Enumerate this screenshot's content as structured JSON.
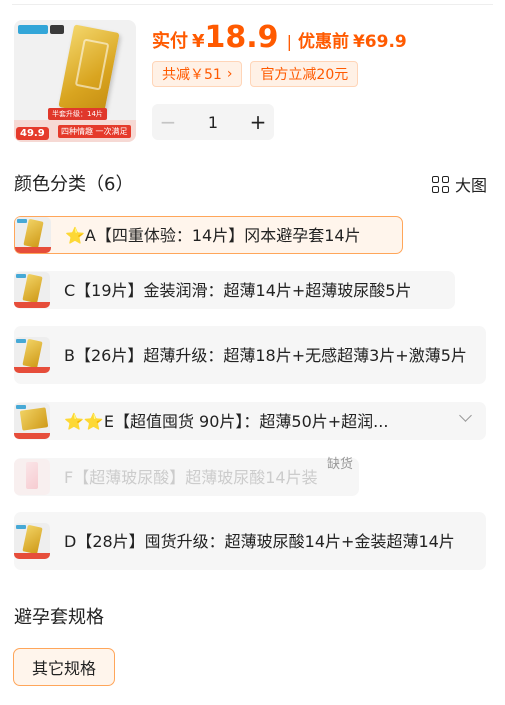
{
  "product": {
    "thumb_price": "49.9",
    "thumb_slogan": "四种情趣 一次满足",
    "thumb_tag": "半套升级：14片"
  },
  "price": {
    "paid_label": "实付",
    "currency": "¥",
    "paid_amount": "18.9",
    "separator": "|",
    "original_label": "优惠前",
    "original_amount": "¥69.9"
  },
  "coupons": [
    {
      "label": "共减￥51",
      "has_arrow": true
    },
    {
      "label": "官方立减20元",
      "has_arrow": false
    }
  ],
  "quantity": {
    "minus": "−",
    "value": "1",
    "plus": "+"
  },
  "color_section": {
    "title": "颜色分类（6）",
    "big_view_label": "大图"
  },
  "options": [
    {
      "label": "⭐A【四重体验：14片】冈本避孕套14片",
      "state": "selected"
    },
    {
      "label": "C【19片】金装润滑：超薄14片+超薄玻尿酸5片",
      "state": "normal"
    },
    {
      "label": "B【26片】超薄升级：超薄18片+无感超薄3片+激薄5片",
      "state": "normal"
    },
    {
      "label": "⭐⭐E【超值囤货 90片】：超薄50片+超润...",
      "state": "collapsed"
    },
    {
      "label": "F【超薄玻尿酸】超薄玻尿酸14片装",
      "state": "disabled",
      "badge": "缺货"
    },
    {
      "label": "D【28片】囤货升级：超薄玻尿酸14片+金装超薄14片",
      "state": "normal"
    }
  ],
  "spec_section": {
    "title": "避孕套规格",
    "option_label": "其它规格"
  },
  "colors": {
    "accent": "#ff5a00",
    "selected_border": "#ffa65a",
    "selected_bg": "#fff5ec",
    "option_bg": "#f6f6f6"
  }
}
